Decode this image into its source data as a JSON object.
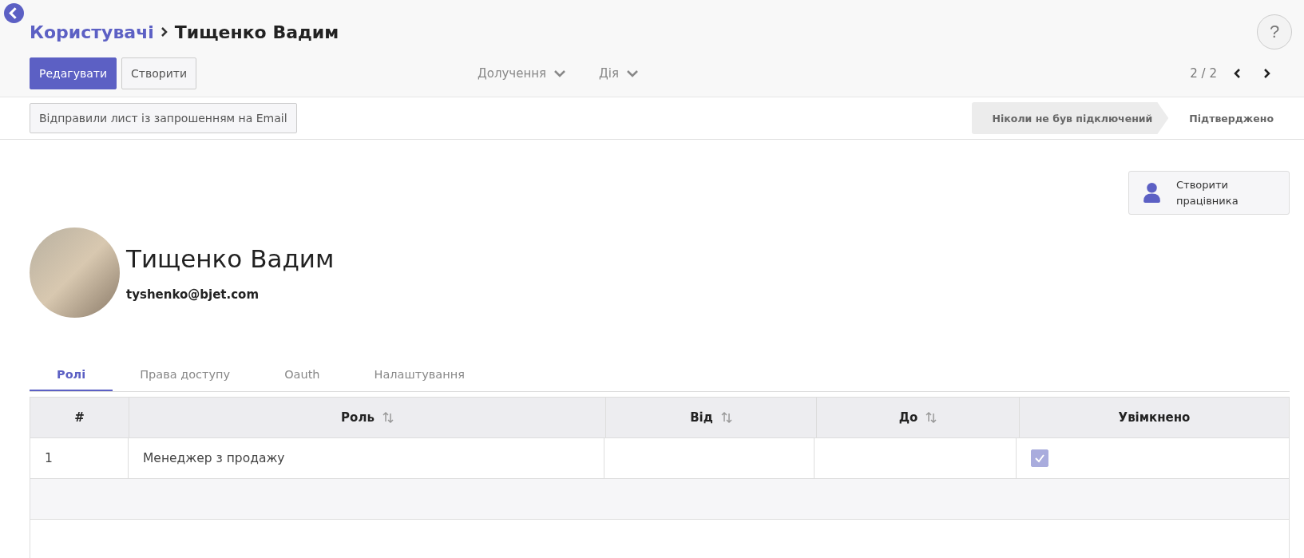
{
  "header": {
    "breadcrumb": {
      "parent": "Користувачі",
      "current": "Тищенко Вадим"
    },
    "buttons": [
      {
        "label": "Редагувати",
        "primary": true
      },
      {
        "label": "Створити",
        "primary": false
      }
    ],
    "menus": [
      "Долучення",
      "Дія"
    ],
    "pager": "2 / 2",
    "help": "?"
  },
  "status_bar": {
    "action": "Відправили лист із запрошенням на Email",
    "steps": [
      {
        "label": "Ніколи не був підключений",
        "selected": true
      },
      {
        "label": "Підтверджено",
        "selected": false
      }
    ]
  },
  "smart_button": "Створити працівника",
  "profile": {
    "name": "Тищенко Вадим",
    "email": "tyshenko@bjet.com"
  },
  "tabs": [
    {
      "label": "Ролі",
      "selected": true
    },
    {
      "label": "Права доступу",
      "selected": false
    },
    {
      "label": "Oauth",
      "selected": false
    },
    {
      "label": "Налаштування",
      "selected": false
    }
  ],
  "table": {
    "columns": [
      {
        "label": "#",
        "sortable": false
      },
      {
        "label": "Роль",
        "sortable": true
      },
      {
        "label": "Від",
        "sortable": true
      },
      {
        "label": "До",
        "sortable": true
      },
      {
        "label": "Увімкнено",
        "sortable": false
      }
    ],
    "rows": [
      {
        "number": "1",
        "role": "Менеджер з продажу",
        "enabled": true
      }
    ]
  }
}
